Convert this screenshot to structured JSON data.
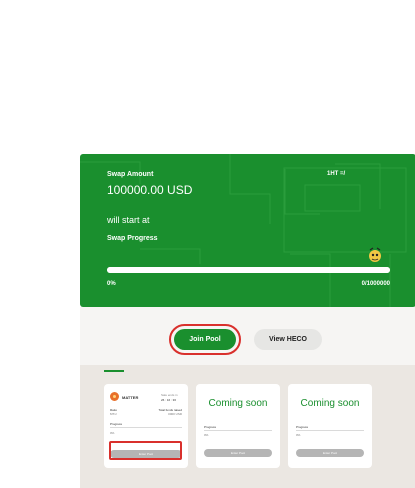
{
  "hero": {
    "swap_label": "Swap Amount",
    "swap_amount": "100000.00 USD",
    "rate": "1HT =/",
    "start_text": "will start at",
    "progress_label": "Swap Progress",
    "progress_fraction": 1.0,
    "progress_percent": "0%",
    "progress_count": "0/1000000",
    "colors": {
      "brand_green": "#1a8f2e",
      "track": "#d9e4da"
    }
  },
  "actions": {
    "join_pool": "Join Pool",
    "view_heco": "View HECO",
    "highlight_color": "#d9302c"
  },
  "pools": [
    {
      "name": "MATTER",
      "sale_end_label": "Sale ends in",
      "countdown": "26 : 16 : 36",
      "ratio_label": "Ratio",
      "ratio_value": "MTx/",
      "funds_label": "Total funds raised",
      "funds_value": "0000 USD",
      "progress_label": "Progress",
      "progress_percent": "0%",
      "enter_label": "Enter Pool"
    },
    {
      "title": "Coming soon",
      "progress_label": "Progress",
      "progress_percent": "0%",
      "enter_label": "Enter Pool"
    },
    {
      "title": "Coming soon",
      "progress_label": "Progress",
      "progress_percent": "0%",
      "enter_label": "Enter Pool"
    }
  ]
}
